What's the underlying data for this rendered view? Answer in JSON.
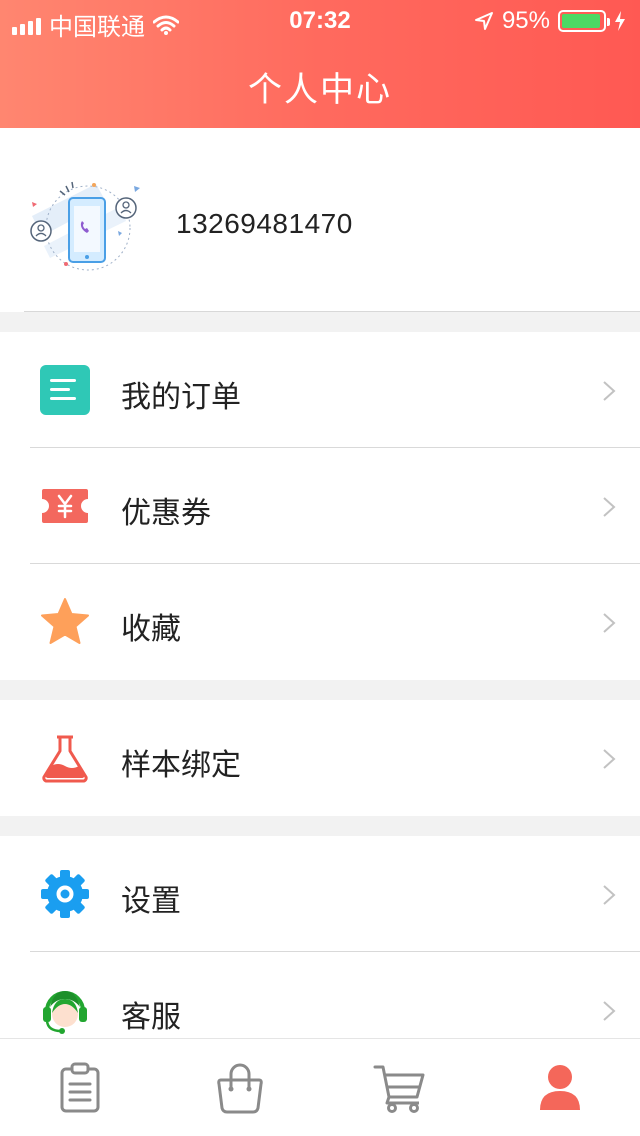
{
  "status_bar": {
    "carrier": "中国联通",
    "time": "07:32",
    "battery": "95%",
    "battery_level": 0.95
  },
  "header": {
    "title": "个人中心"
  },
  "profile": {
    "phone": "13269481470",
    "avatar_icon": "phone-call-illustration"
  },
  "menu": {
    "orders": {
      "label": "我的订单",
      "icon": "order-list-icon"
    },
    "coupons": {
      "label": "优惠券",
      "icon": "coupon-icon"
    },
    "favorites": {
      "label": "收藏",
      "icon": "star-icon"
    },
    "sample_binding": {
      "label": "样本绑定",
      "icon": "flask-icon"
    },
    "settings": {
      "label": "设置",
      "icon": "gear-icon"
    },
    "customer_service": {
      "label": "客服",
      "icon": "headset-icon"
    }
  },
  "tabbar": {
    "tabs": [
      {
        "icon": "clipboard-icon",
        "active": false
      },
      {
        "icon": "shopping-bag-icon",
        "active": false
      },
      {
        "icon": "cart-icon",
        "active": false
      },
      {
        "icon": "user-icon",
        "active": true
      }
    ]
  },
  "colors": {
    "header_gradient_start": "#ff8670",
    "header_gradient_end": "#ff5953",
    "active_tab": "#f4675a",
    "inactive_tab": "#8a8a8a"
  }
}
